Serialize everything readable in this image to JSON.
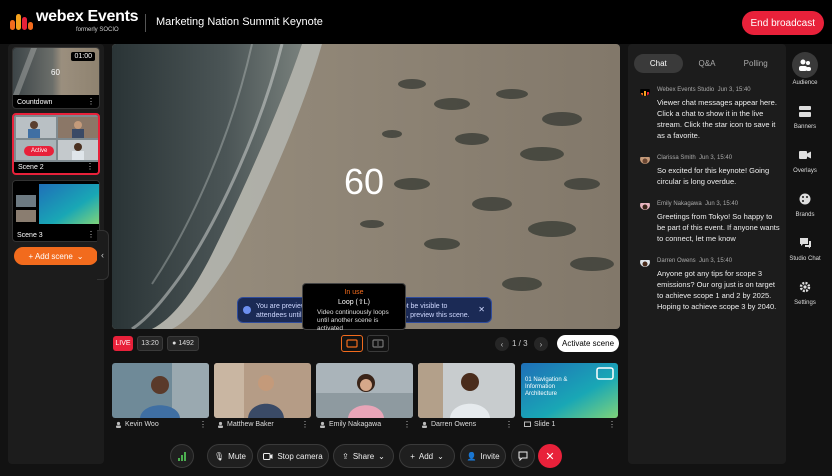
{
  "header": {
    "brand": "webex Events",
    "brand_sub": "formerly SOCIO",
    "event_title": "Marketing Nation Summit Keynote",
    "end_broadcast_label": "End broadcast"
  },
  "scenes": {
    "items": [
      {
        "label": "Countdown",
        "timer": "01:00",
        "preview_number": "60"
      },
      {
        "label": "Scene 2",
        "badge": "Active"
      },
      {
        "label": "Scene 3"
      }
    ],
    "add_label": "+ Add scene"
  },
  "stage": {
    "countdown": "60",
    "banner_text": "You are previewing this scene. The scene will not be visible to attendees until the scene is activated. Otherwise, preview this scene.",
    "tooltip": {
      "title": "In use",
      "mode": "Loop (⇧L)",
      "description": "Video continuously loops until another scene is activated"
    }
  },
  "controls": {
    "live": "LIVE",
    "duration": "13:20",
    "viewers": "1492",
    "page": "1 / 3",
    "activate_label": "Activate scene"
  },
  "sources": [
    {
      "name": "Kevin Woo"
    },
    {
      "name": "Matthew Baker"
    },
    {
      "name": "Emily Nakagawa"
    },
    {
      "name": "Darren Owens"
    },
    {
      "name": "Slide 1",
      "slide_text": "01 Navigation & Information Architecture"
    }
  ],
  "toolbar": {
    "mute": "Mute",
    "stop_camera": "Stop camera",
    "share": "Share",
    "add": "Add",
    "invite": "Invite"
  },
  "chat": {
    "tabs": [
      "Chat",
      "Q&A",
      "Polling"
    ],
    "messages": [
      {
        "author": "Webex Events Studio",
        "time": "Jun 3, 15:40",
        "text": "Viewer chat messages appear here. Click a chat to show it in the live stream. Click the star icon to save it as a favorite."
      },
      {
        "author": "Clarissa Smith",
        "time": "Jun 3, 15:40",
        "text": "So excited for this keynote! Going circular is long overdue."
      },
      {
        "author": "Emily Nakagawa",
        "time": "Jun 3, 15:40",
        "text": "Greetings from Tokyo! So happy to be part of this event. If anyone wants to connect, let me know"
      },
      {
        "author": "Darren Owens",
        "time": "Jun 3, 15:40",
        "text": "Anyone got any tips for scope 3 emissions? Our org just is on target to achieve scope 1 and 2 by 2025. Hoping to achieve scope 3 by 2040."
      }
    ]
  },
  "rail": {
    "items": [
      "Audience",
      "Banners",
      "Overlays",
      "Brands",
      "Studio Chat",
      "Settings"
    ]
  },
  "colors": {
    "accent_red": "#e8213a",
    "accent_orange": "#f26b1d",
    "banner_blue": "#1b2a55"
  }
}
